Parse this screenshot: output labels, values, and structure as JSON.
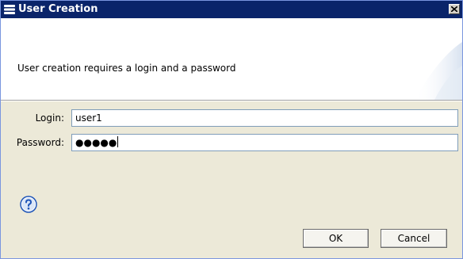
{
  "window": {
    "title": "User Creation",
    "icons": {
      "app": "eclipse-icon",
      "close": "close-icon",
      "help": "help-icon"
    }
  },
  "banner": {
    "message": "User creation requires a login and a password"
  },
  "form": {
    "login_label": "Login:",
    "login_value": "user1",
    "password_label": "Password:",
    "password_value": "●●●●●"
  },
  "buttons": {
    "ok_label": "OK",
    "cancel_label": "Cancel"
  },
  "colors": {
    "titlebar": "#0a246a",
    "dialog_bg": "#ece9d8",
    "banner_bg": "#ffffff",
    "field_border": "#7f9db9",
    "help_blue": "#1f55b8"
  }
}
